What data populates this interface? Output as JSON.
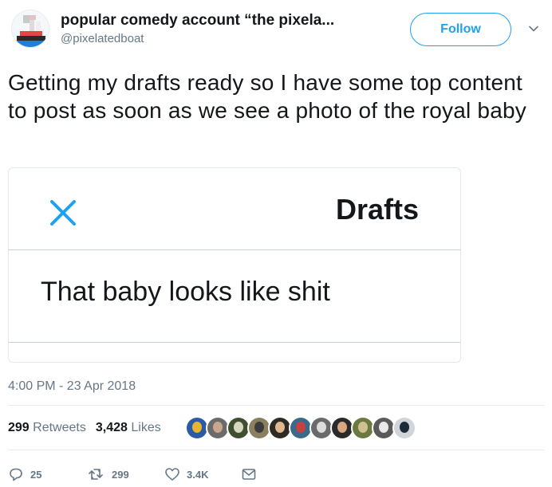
{
  "author": {
    "name": "popular comedy account “the pixela...",
    "handle": "@pixelatedboat"
  },
  "follow_label": "Follow",
  "tweet_text": "Getting my drafts ready so I have some top content to post as soon as we see a photo of the royal baby",
  "card": {
    "header": "Drafts",
    "draft": "That baby looks like shit"
  },
  "timestamp": "4:00 PM - 23 Apr 2018",
  "stats": {
    "retweets_count": "299",
    "retweets_label": "Retweets",
    "likes_count": "3,428",
    "likes_label": "Likes"
  },
  "actions": {
    "replies": "25",
    "retweets": "299",
    "likes": "3.4K"
  },
  "colors": {
    "accent": "#1da1f2",
    "muted": "#657786",
    "text": "#14171a"
  }
}
